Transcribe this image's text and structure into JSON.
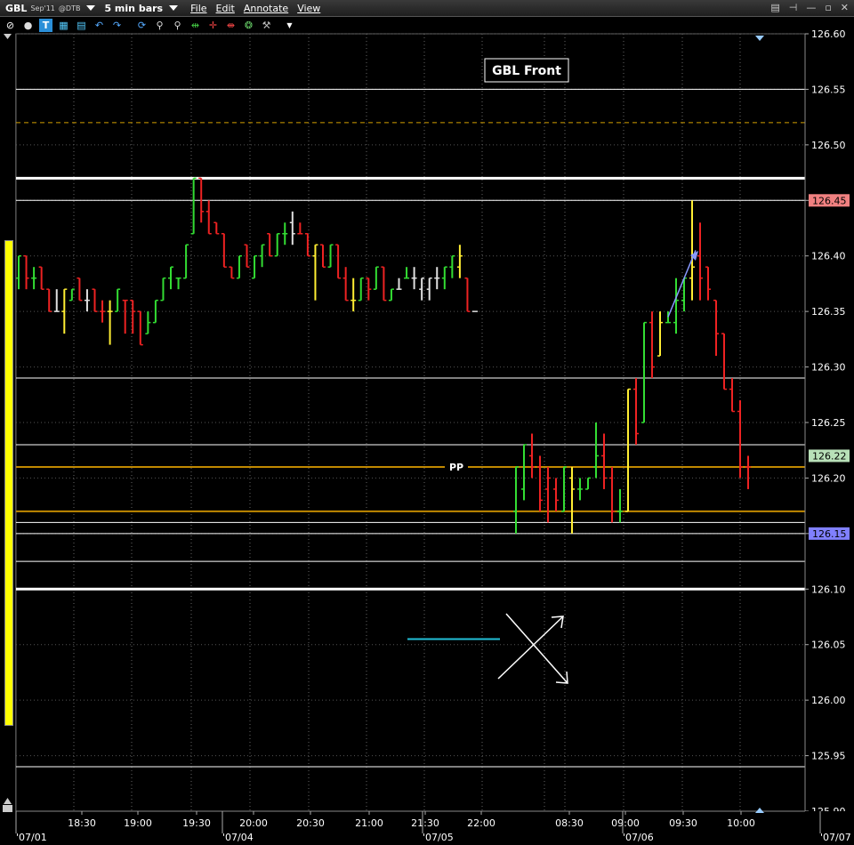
{
  "window": {
    "symbol": "GBL",
    "contract": "Sep'11",
    "exchange": "@DTB",
    "bar_size": "5 min bars",
    "menu": [
      "File",
      "Edit",
      "Annotate",
      "View"
    ]
  },
  "toolbar_icons": [
    "crosshair-icon",
    "circle-icon",
    "text-icon",
    "grid-icon",
    "line-icon",
    "undo-icon",
    "redo-icon",
    "refresh-icon",
    "zoom-icon",
    "zoom-out-icon",
    "range-icon",
    "cursor-icon",
    "pan-icon",
    "color-icon",
    "wrench-icon",
    "dropdown-icon"
  ],
  "chart_data": {
    "type": "ohlc",
    "title": "GBL Front",
    "y_axis": {
      "min": 125.9,
      "max": 126.6,
      "ticks": [
        "126.60",
        "126.55",
        "126.50",
        "126.45",
        "126.40",
        "126.35",
        "126.30",
        "126.25",
        "126.20",
        "126.15",
        "126.10",
        "126.05",
        "126.00",
        "125.95",
        "125.90"
      ]
    },
    "x_ticks": [
      {
        "label": "'07/01",
        "major": true
      },
      {
        "label": "18:30",
        "major": false
      },
      {
        "label": "19:00",
        "major": false
      },
      {
        "label": "19:30",
        "major": false
      },
      {
        "label": "'07/04",
        "major": true
      },
      {
        "label": "20:00",
        "major": false
      },
      {
        "label": "20:30",
        "major": false
      },
      {
        "label": "21:00",
        "major": false
      },
      {
        "label": "21:30",
        "major": false
      },
      {
        "label": "'07/05",
        "major": true
      },
      {
        "label": "22:00",
        "major": false
      },
      {
        "label": "08:30",
        "major": false
      },
      {
        "label": "09:00",
        "major": false
      },
      {
        "label": "'07/06",
        "major": true
      },
      {
        "label": "09:30",
        "major": false
      },
      {
        "label": "10:00",
        "major": false
      },
      {
        "label": "'07/07",
        "major": true
      }
    ],
    "price_badges": [
      {
        "value": "126.45",
        "color": "#f08080"
      },
      {
        "value": "126.22",
        "color": "#b8e0b8"
      },
      {
        "value": "126.15",
        "color": "#8080ff"
      }
    ],
    "horizontal_lines": [
      {
        "price": 126.55,
        "color": "#ffffff",
        "style": "solid",
        "weight": 1
      },
      {
        "price": 126.52,
        "color": "#d4a000",
        "style": "dashed",
        "weight": 1
      },
      {
        "price": 126.47,
        "color": "#ffffff",
        "style": "solid",
        "weight": 3
      },
      {
        "price": 126.45,
        "color": "#ffffff",
        "style": "solid",
        "weight": 1
      },
      {
        "price": 126.29,
        "color": "#ffffff",
        "style": "solid",
        "weight": 1
      },
      {
        "price": 126.23,
        "color": "#ffffff",
        "style": "solid",
        "weight": 1
      },
      {
        "price": 126.21,
        "color": "#c08800",
        "style": "solid",
        "weight": 2
      },
      {
        "price": 126.17,
        "color": "#c08800",
        "style": "solid",
        "weight": 2
      },
      {
        "price": 126.16,
        "color": "#ffffff",
        "style": "solid",
        "weight": 1
      },
      {
        "price": 126.15,
        "color": "#ffffff",
        "style": "solid",
        "weight": 1
      },
      {
        "price": 126.125,
        "color": "#ffffff",
        "style": "solid",
        "weight": 1
      },
      {
        "price": 126.1,
        "color": "#ffffff",
        "style": "solid",
        "weight": 3
      },
      {
        "price": 125.94,
        "color": "#ffffff",
        "style": "solid",
        "weight": 1
      }
    ],
    "pp_label": "PP",
    "bars": [
      {
        "o": 126.38,
        "h": 126.4,
        "l": 126.37,
        "c": 126.4,
        "col": "g"
      },
      {
        "o": 126.4,
        "h": 126.4,
        "l": 126.37,
        "c": 126.38,
        "col": "r"
      },
      {
        "o": 126.38,
        "h": 126.39,
        "l": 126.37,
        "c": 126.38,
        "col": "g"
      },
      {
        "o": 126.39,
        "h": 126.39,
        "l": 126.37,
        "c": 126.37,
        "col": "r"
      },
      {
        "o": 126.37,
        "h": 126.37,
        "l": 126.35,
        "c": 126.35,
        "col": "r"
      },
      {
        "o": 126.35,
        "h": 126.37,
        "l": 126.35,
        "c": 126.35,
        "col": "w"
      },
      {
        "o": 126.35,
        "h": 126.37,
        "l": 126.33,
        "c": 126.37,
        "col": "y"
      },
      {
        "o": 126.36,
        "h": 126.37,
        "l": 126.36,
        "c": 126.37,
        "col": "g"
      },
      {
        "o": 126.38,
        "h": 126.38,
        "l": 126.36,
        "c": 126.36,
        "col": "r"
      },
      {
        "o": 126.36,
        "h": 126.37,
        "l": 126.35,
        "c": 126.36,
        "col": "w"
      },
      {
        "o": 126.37,
        "h": 126.37,
        "l": 126.35,
        "c": 126.35,
        "col": "r"
      },
      {
        "o": 126.35,
        "h": 126.36,
        "l": 126.34,
        "c": 126.35,
        "col": "r"
      },
      {
        "o": 126.35,
        "h": 126.36,
        "l": 126.32,
        "c": 126.35,
        "col": "y"
      },
      {
        "o": 126.35,
        "h": 126.37,
        "l": 126.35,
        "c": 126.37,
        "col": "g"
      },
      {
        "o": 126.36,
        "h": 126.36,
        "l": 126.33,
        "c": 126.36,
        "col": "r"
      },
      {
        "o": 126.36,
        "h": 126.36,
        "l": 126.33,
        "c": 126.35,
        "col": "r"
      },
      {
        "o": 126.35,
        "h": 126.35,
        "l": 126.32,
        "c": 126.32,
        "col": "r"
      },
      {
        "o": 126.33,
        "h": 126.35,
        "l": 126.33,
        "c": 126.34,
        "col": "g"
      },
      {
        "o": 126.34,
        "h": 126.36,
        "l": 126.34,
        "c": 126.36,
        "col": "g"
      },
      {
        "o": 126.36,
        "h": 126.38,
        "l": 126.36,
        "c": 126.38,
        "col": "g"
      },
      {
        "o": 126.38,
        "h": 126.39,
        "l": 126.37,
        "c": 126.39,
        "col": "g"
      },
      {
        "o": 126.38,
        "h": 126.38,
        "l": 126.37,
        "c": 126.38,
        "col": "g"
      },
      {
        "o": 126.38,
        "h": 126.41,
        "l": 126.38,
        "c": 126.41,
        "col": "g"
      },
      {
        "o": 126.42,
        "h": 126.47,
        "l": 126.42,
        "c": 126.47,
        "col": "g"
      },
      {
        "o": 126.47,
        "h": 126.47,
        "l": 126.43,
        "c": 126.44,
        "col": "r"
      },
      {
        "o": 126.44,
        "h": 126.45,
        "l": 126.42,
        "c": 126.42,
        "col": "r"
      },
      {
        "o": 126.43,
        "h": 126.43,
        "l": 126.42,
        "c": 126.42,
        "col": "r"
      },
      {
        "o": 126.42,
        "h": 126.42,
        "l": 126.39,
        "c": 126.39,
        "col": "r"
      },
      {
        "o": 126.39,
        "h": 126.39,
        "l": 126.38,
        "c": 126.38,
        "col": "r"
      },
      {
        "o": 126.38,
        "h": 126.4,
        "l": 126.38,
        "c": 126.4,
        "col": "g"
      },
      {
        "o": 126.41,
        "h": 126.41,
        "l": 126.39,
        "c": 126.39,
        "col": "r"
      },
      {
        "o": 126.38,
        "h": 126.4,
        "l": 126.38,
        "c": 126.4,
        "col": "g"
      },
      {
        "o": 126.4,
        "h": 126.41,
        "l": 126.39,
        "c": 126.41,
        "col": "g"
      },
      {
        "o": 126.42,
        "h": 126.42,
        "l": 126.4,
        "c": 126.4,
        "col": "r"
      },
      {
        "o": 126.4,
        "h": 126.42,
        "l": 126.4,
        "c": 126.42,
        "col": "g"
      },
      {
        "o": 126.42,
        "h": 126.43,
        "l": 126.41,
        "c": 126.42,
        "col": "g"
      },
      {
        "o": 126.43,
        "h": 126.44,
        "l": 126.41,
        "c": 126.42,
        "col": "w"
      },
      {
        "o": 126.42,
        "h": 126.43,
        "l": 126.42,
        "c": 126.42,
        "col": "r"
      },
      {
        "o": 126.42,
        "h": 126.42,
        "l": 126.4,
        "c": 126.4,
        "col": "r"
      },
      {
        "o": 126.4,
        "h": 126.41,
        "l": 126.36,
        "c": 126.41,
        "col": "y"
      },
      {
        "o": 126.41,
        "h": 126.41,
        "l": 126.39,
        "c": 126.39,
        "col": "r"
      },
      {
        "o": 126.39,
        "h": 126.41,
        "l": 126.39,
        "c": 126.41,
        "col": "g"
      },
      {
        "o": 126.41,
        "h": 126.41,
        "l": 126.38,
        "c": 126.38,
        "col": "r"
      },
      {
        "o": 126.38,
        "h": 126.39,
        "l": 126.36,
        "c": 126.36,
        "col": "r"
      },
      {
        "o": 126.36,
        "h": 126.38,
        "l": 126.35,
        "c": 126.36,
        "col": "y"
      },
      {
        "o": 126.36,
        "h": 126.38,
        "l": 126.36,
        "c": 126.38,
        "col": "g"
      },
      {
        "o": 126.38,
        "h": 126.38,
        "l": 126.36,
        "c": 126.37,
        "col": "r"
      },
      {
        "o": 126.37,
        "h": 126.39,
        "l": 126.37,
        "c": 126.39,
        "col": "g"
      },
      {
        "o": 126.39,
        "h": 126.39,
        "l": 126.36,
        "c": 126.36,
        "col": "r"
      },
      {
        "o": 126.36,
        "h": 126.37,
        "l": 126.36,
        "c": 126.37,
        "col": "g"
      },
      {
        "o": 126.37,
        "h": 126.38,
        "l": 126.37,
        "c": 126.37,
        "col": "w"
      },
      {
        "o": 126.38,
        "h": 126.39,
        "l": 126.38,
        "c": 126.38,
        "col": "g"
      },
      {
        "o": 126.38,
        "h": 126.39,
        "l": 126.37,
        "c": 126.38,
        "col": "w"
      },
      {
        "o": 126.37,
        "h": 126.38,
        "l": 126.36,
        "c": 126.38,
        "col": "w"
      },
      {
        "o": 126.37,
        "h": 126.38,
        "l": 126.36,
        "c": 126.38,
        "col": "w"
      },
      {
        "o": 126.38,
        "h": 126.39,
        "l": 126.37,
        "c": 126.38,
        "col": "w"
      },
      {
        "o": 126.38,
        "h": 126.39,
        "l": 126.37,
        "c": 126.39,
        "col": "g"
      },
      {
        "o": 126.39,
        "h": 126.4,
        "l": 126.38,
        "c": 126.4,
        "col": "g"
      },
      {
        "o": 126.39,
        "h": 126.41,
        "l": 126.38,
        "c": 126.4,
        "col": "y"
      },
      {
        "o": 126.38,
        "h": 126.38,
        "l": 126.35,
        "c": 126.35,
        "col": "r"
      },
      {
        "o": 126.35,
        "h": 126.35,
        "l": 126.35,
        "c": 126.35,
        "col": "w"
      },
      {
        "gap": true
      },
      {
        "o": 126.17,
        "h": 126.21,
        "l": 126.15,
        "c": 126.21,
        "col": "g"
      },
      {
        "o": 126.19,
        "h": 126.23,
        "l": 126.18,
        "c": 126.23,
        "col": "g"
      },
      {
        "o": 126.22,
        "h": 126.24,
        "l": 126.2,
        "c": 126.21,
        "col": "r"
      },
      {
        "o": 126.21,
        "h": 126.22,
        "l": 126.17,
        "c": 126.18,
        "col": "r"
      },
      {
        "o": 126.19,
        "h": 126.21,
        "l": 126.16,
        "c": 126.2,
        "col": "r"
      },
      {
        "o": 126.19,
        "h": 126.2,
        "l": 126.17,
        "c": 126.18,
        "col": "r"
      },
      {
        "o": 126.17,
        "h": 126.21,
        "l": 126.17,
        "c": 126.21,
        "col": "g"
      },
      {
        "o": 126.2,
        "h": 126.21,
        "l": 126.15,
        "c": 126.19,
        "col": "y"
      },
      {
        "o": 126.19,
        "h": 126.2,
        "l": 126.18,
        "c": 126.19,
        "col": "g"
      },
      {
        "o": 126.19,
        "h": 126.2,
        "l": 126.19,
        "c": 126.2,
        "col": "g"
      },
      {
        "o": 126.21,
        "h": 126.25,
        "l": 126.2,
        "c": 126.22,
        "col": "g"
      },
      {
        "o": 126.22,
        "h": 126.24,
        "l": 126.19,
        "c": 126.2,
        "col": "r"
      },
      {
        "o": 126.2,
        "h": 126.21,
        "l": 126.16,
        "c": 126.17,
        "col": "r"
      },
      {
        "o": 126.17,
        "h": 126.19,
        "l": 126.16,
        "c": 126.17,
        "col": "g"
      },
      {
        "o": 126.17,
        "h": 126.28,
        "l": 126.17,
        "c": 126.28,
        "col": "y"
      },
      {
        "o": 126.28,
        "h": 126.29,
        "l": 126.23,
        "c": 126.24,
        "col": "r"
      },
      {
        "o": 126.25,
        "h": 126.34,
        "l": 126.25,
        "c": 126.34,
        "col": "g"
      },
      {
        "o": 126.34,
        "h": 126.35,
        "l": 126.29,
        "c": 126.3,
        "col": "r"
      },
      {
        "o": 126.31,
        "h": 126.35,
        "l": 126.31,
        "c": 126.34,
        "col": "y"
      },
      {
        "o": 126.34,
        "h": 126.35,
        "l": 126.34,
        "c": 126.34,
        "col": "g"
      },
      {
        "o": 126.34,
        "h": 126.38,
        "l": 126.33,
        "c": 126.36,
        "col": "g"
      },
      {
        "o": 126.36,
        "h": 126.38,
        "l": 126.35,
        "c": 126.38,
        "col": "g"
      },
      {
        "o": 126.38,
        "h": 126.45,
        "l": 126.36,
        "c": 126.39,
        "col": "y"
      },
      {
        "o": 126.4,
        "h": 126.43,
        "l": 126.36,
        "c": 126.38,
        "col": "r"
      },
      {
        "o": 126.39,
        "h": 126.39,
        "l": 126.36,
        "c": 126.37,
        "col": "r"
      },
      {
        "o": 126.36,
        "h": 126.36,
        "l": 126.31,
        "c": 126.33,
        "col": "r"
      },
      {
        "o": 126.33,
        "h": 126.33,
        "l": 126.28,
        "c": 126.28,
        "col": "r"
      },
      {
        "o": 126.28,
        "h": 126.29,
        "l": 126.26,
        "c": 126.26,
        "col": "r"
      },
      {
        "o": 126.26,
        "h": 126.27,
        "l": 126.2,
        "c": 126.21,
        "col": "r"
      },
      {
        "o": 126.21,
        "h": 126.22,
        "l": 126.19,
        "c": 126.21,
        "col": "r"
      }
    ],
    "annotations": {
      "blue_arrow": {
        "from_bar": 79,
        "from_price": 126.35,
        "to_bar": 83,
        "to_price": 126.41
      },
      "cyan_line": {
        "price": 126.055
      },
      "cross_arrows": true
    }
  }
}
